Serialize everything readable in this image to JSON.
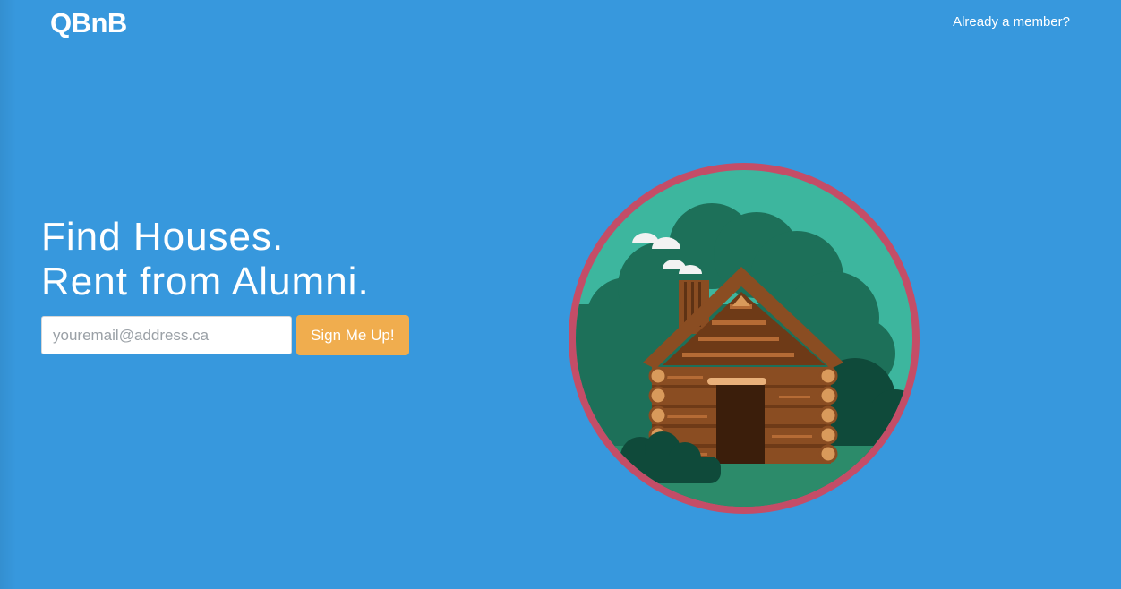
{
  "header": {
    "logo": "QBnB",
    "login_link": "Already a member?"
  },
  "hero": {
    "headline_line1": "Find Houses.",
    "headline_line2": "Rent from Alumni.",
    "email_placeholder": "youremail@address.ca",
    "signup_label": "Sign Me Up!"
  },
  "illustration": {
    "subject": "log-cabin-in-forest",
    "colors": {
      "background": "#3798dd",
      "ring": "#c44d67",
      "sky": "#3db69e",
      "forest": "#1d7059",
      "forest_dark": "#0f4a3a",
      "wood": "#8a4d22",
      "wood_light": "#b56b35",
      "door": "#3b1e0b",
      "smoke": "#f2f2f2",
      "button": "#f0ad4e"
    }
  }
}
